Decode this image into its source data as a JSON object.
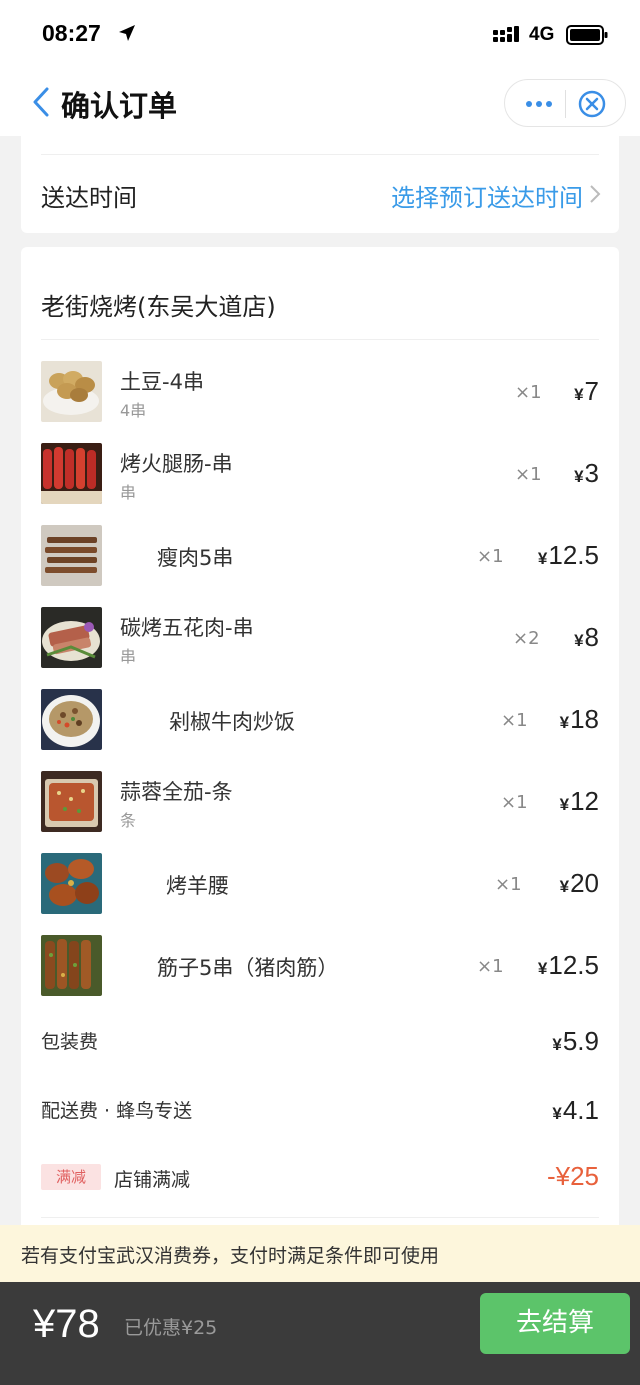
{
  "status_bar": {
    "time": "08:27",
    "network": "4G"
  },
  "nav": {
    "title": "确认订单"
  },
  "delivery": {
    "label": "送达时间",
    "action": "选择预订送达时间"
  },
  "order": {
    "shop_name": "老街烧烤(东吴大道店)",
    "currency": "¥",
    "items": [
      {
        "name": "土豆-4串",
        "spec": "4串",
        "qty": "×1",
        "price": "7"
      },
      {
        "name": "烤火腿肠-串",
        "spec": "串",
        "qty": "×1",
        "price": "3"
      },
      {
        "name": "瘦肉5串",
        "spec": "",
        "qty": "×1",
        "price": "12.5"
      },
      {
        "name": "碳烤五花肉-串",
        "spec": "串",
        "qty": "×2",
        "price": "8"
      },
      {
        "name": "剁椒牛肉炒饭",
        "spec": "",
        "qty": "×1",
        "price": "18"
      },
      {
        "name": "蒜蓉全茄-条",
        "spec": "条",
        "qty": "×1",
        "price": "12"
      },
      {
        "name": "烤羊腰",
        "spec": "",
        "qty": "×1",
        "price": "20"
      },
      {
        "name": "筋子5串（猪肉筋）",
        "spec": "",
        "qty": "×1",
        "price": "12.5"
      }
    ],
    "packaging": {
      "label": "包装费",
      "value": "5.9"
    },
    "delivery_fee": {
      "label": "配送费 · 蜂鸟专送",
      "value": "4.1"
    },
    "discount": {
      "badge": "满减",
      "label": "店铺满减",
      "value": "-¥25"
    }
  },
  "notice": {
    "text": "若有支付宝武汉消费券，支付时满足条件即可使用"
  },
  "bottom": {
    "total": "¥78",
    "saved": "已优惠¥25",
    "checkout": "去结算"
  },
  "colors": {
    "accent_blue": "#3a9be8",
    "checkout_green": "#5cc46a",
    "discount_red": "#e8613c",
    "bottom_bar": "#3b3b3b",
    "notice_bg": "#fdf6dc"
  }
}
